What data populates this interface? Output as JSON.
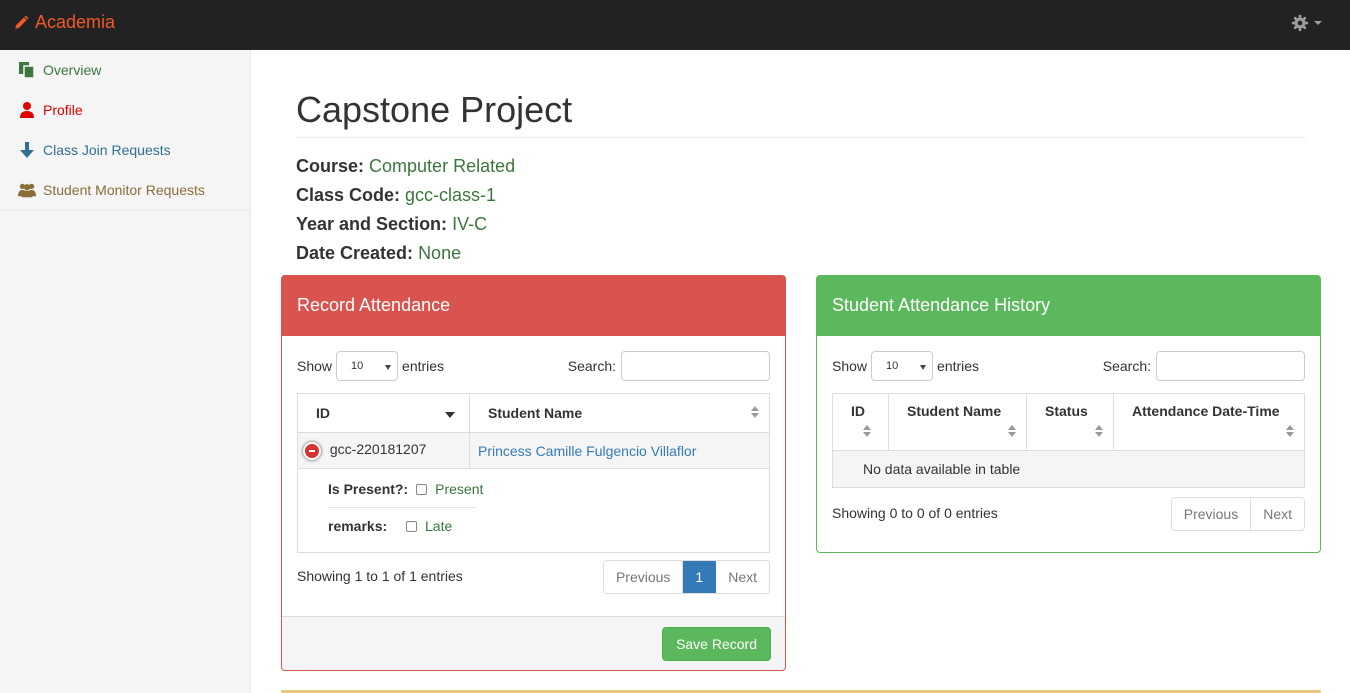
{
  "navbar": {
    "brand": "Academia",
    "brand_color": "#f0592a"
  },
  "sidebar": {
    "items": [
      {
        "label": "Overview",
        "icon": "copy-icon",
        "color": "#3c763d"
      },
      {
        "label": "Profile",
        "icon": "user-icon",
        "color": "#e00000"
      },
      {
        "label": "Class Join Requests",
        "icon": "arrow-down-icon",
        "color": "#31708f"
      },
      {
        "label": "Student Monitor Requests",
        "icon": "users-icon",
        "color": "#8a6d3b"
      }
    ]
  },
  "page": {
    "title": "Capstone Project",
    "info": [
      {
        "key": "Course:",
        "value": "Computer Related"
      },
      {
        "key": "Class Code:",
        "value": "gcc-class-1"
      },
      {
        "key": "Year and Section:",
        "value": "IV-C"
      },
      {
        "key": "Date Created:",
        "value": "None"
      }
    ]
  },
  "record_panel": {
    "title": "Record Attendance",
    "show_label": "Show",
    "entries_value": "10",
    "entries_label": "entries",
    "search_label": "Search:",
    "columns": [
      "ID",
      "Student Name"
    ],
    "row": {
      "id": "gcc-220181207",
      "name": "Princess Camille Fulgencio Villaflor"
    },
    "child": {
      "present_label": "Is Present?:",
      "present_option": "Present",
      "remarks_label": "remarks:",
      "remarks_option": "Late"
    },
    "info": "Showing 1 to 1 of 1 entries",
    "pager": {
      "prev": "Previous",
      "page": "1",
      "next": "Next"
    },
    "save_label": "Save Record"
  },
  "history_panel": {
    "title": "Student Attendance History",
    "show_label": "Show",
    "entries_value": "10",
    "entries_label": "entries",
    "search_label": "Search:",
    "columns": [
      "ID",
      "Student Name",
      "Status",
      "Attendance Date-Time"
    ],
    "empty": "No data available in table",
    "info": "Showing 0 to 0 of 0 entries",
    "pager": {
      "prev": "Previous",
      "next": "Next"
    }
  }
}
